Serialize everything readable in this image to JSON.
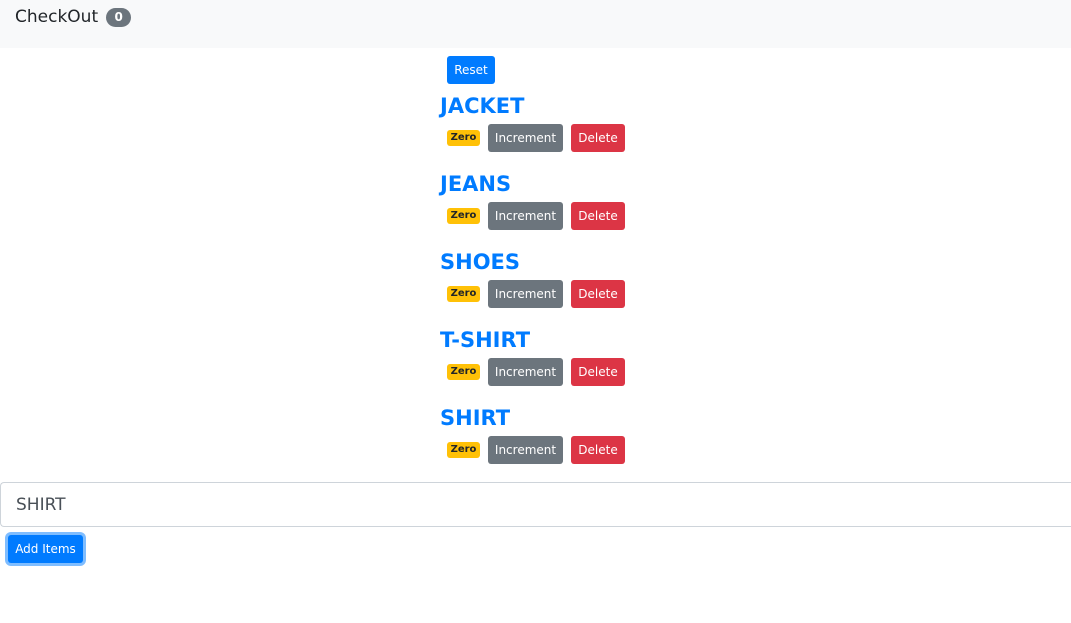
{
  "navbar": {
    "brand": "CheckOut",
    "count_badge": "0"
  },
  "reset_label": "Reset",
  "items": [
    {
      "name": "JACKET",
      "badge": "Zero",
      "increment_label": "Increment",
      "delete_label": "Delete"
    },
    {
      "name": "JEANS",
      "badge": "Zero",
      "increment_label": "Increment",
      "delete_label": "Delete"
    },
    {
      "name": "SHOES",
      "badge": "Zero",
      "increment_label": "Increment",
      "delete_label": "Delete"
    },
    {
      "name": "T-SHIRT",
      "badge": "Zero",
      "increment_label": "Increment",
      "delete_label": "Delete"
    },
    {
      "name": "SHIRT",
      "badge": "Zero",
      "increment_label": "Increment",
      "delete_label": "Delete"
    }
  ],
  "add_form": {
    "input_value": "SHIRT",
    "button_label": "Add Items"
  },
  "colors": {
    "primary": "#007bff",
    "secondary": "#6c757d",
    "danger": "#dc3545",
    "warning": "#ffc107"
  }
}
